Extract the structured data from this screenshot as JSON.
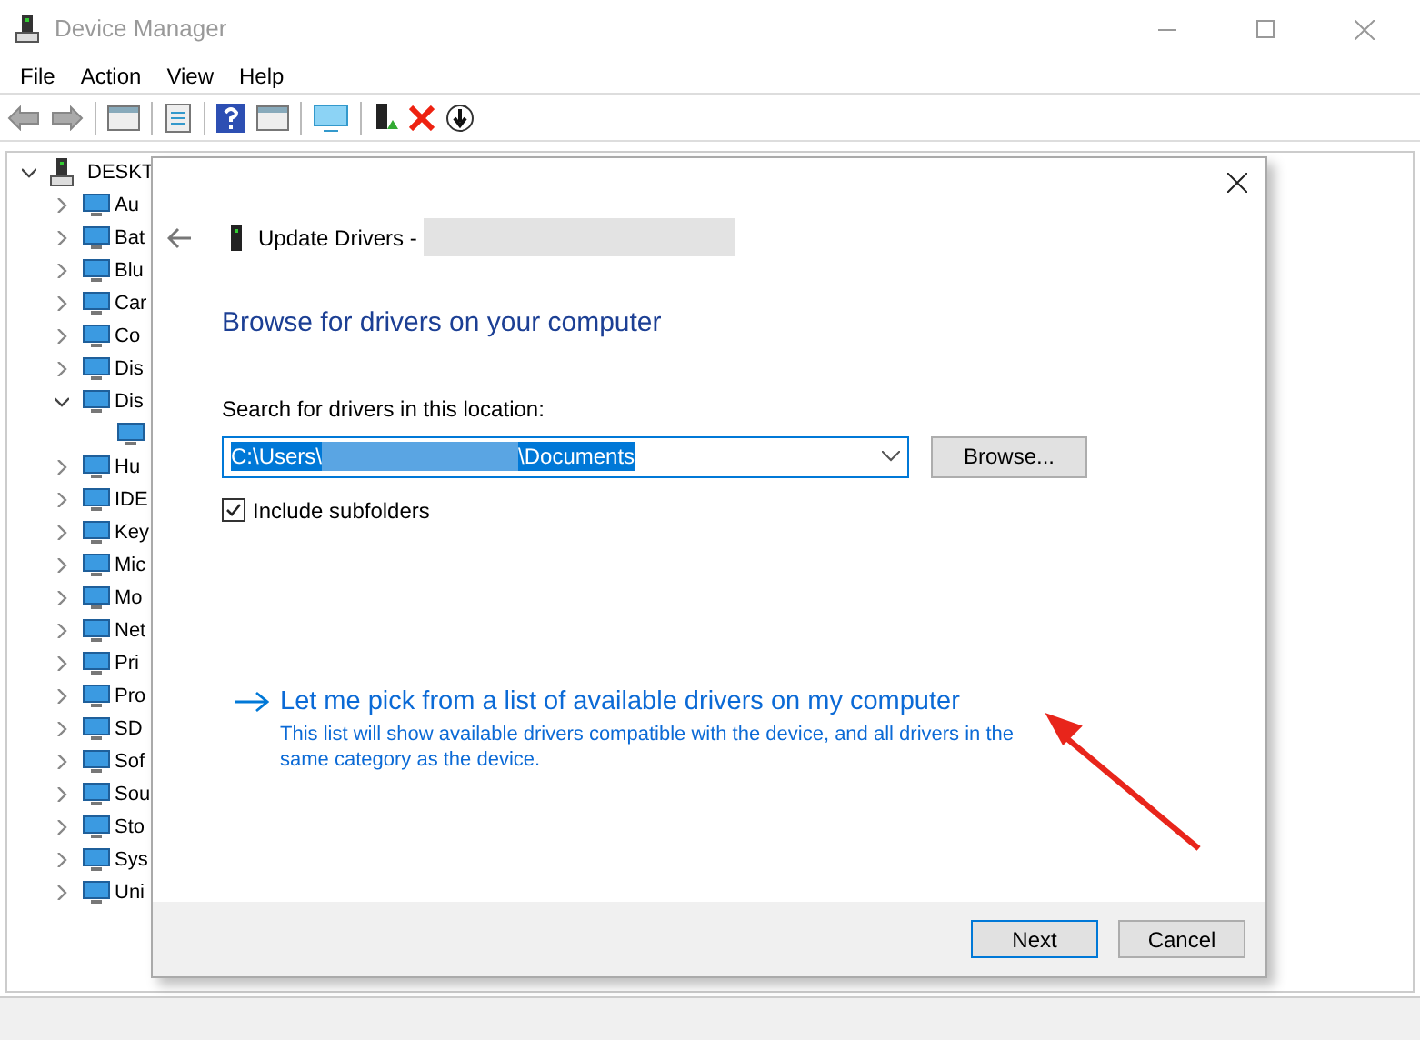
{
  "window": {
    "title": "Device Manager"
  },
  "menu": [
    "File",
    "Action",
    "View",
    "Help"
  ],
  "tree": {
    "root": {
      "label": "DESKT",
      "expanded": true
    },
    "items": [
      {
        "label": "Au",
        "expanded": false
      },
      {
        "label": "Bat",
        "expanded": false
      },
      {
        "label": "Blu",
        "expanded": false
      },
      {
        "label": "Car",
        "expanded": false
      },
      {
        "label": "Co",
        "expanded": false
      },
      {
        "label": "Dis",
        "expanded": false
      },
      {
        "label": "Dis",
        "expanded": true,
        "children": [
          {
            "kind": "device"
          }
        ]
      },
      {
        "label": "Hu",
        "expanded": false
      },
      {
        "label": "IDE",
        "expanded": false
      },
      {
        "label": "Key",
        "expanded": false
      },
      {
        "label": "Mic",
        "expanded": false
      },
      {
        "label": "Mo",
        "expanded": false
      },
      {
        "label": "Net",
        "expanded": false
      },
      {
        "label": "Pri",
        "expanded": false
      },
      {
        "label": "Pro",
        "expanded": false
      },
      {
        "label": "SD",
        "expanded": false
      },
      {
        "label": "Sof",
        "expanded": false
      },
      {
        "label": "Sou",
        "expanded": false
      },
      {
        "label": "Sto",
        "expanded": false
      },
      {
        "label": "Sys",
        "expanded": false
      },
      {
        "label": "Uni",
        "expanded": false
      }
    ]
  },
  "dialog": {
    "title": "Update Drivers -",
    "heading": "Browse for drivers on your computer",
    "search_label": "Search for drivers in this location:",
    "path_start": "C:\\Users\\",
    "path_end": "\\Documents",
    "browse_button": "Browse...",
    "include_subfolders": {
      "label": "Include subfolders",
      "checked": true
    },
    "link": {
      "title": "Let me pick from a list of available drivers on my computer",
      "description": "This list will show available drivers compatible with the device, and all drivers in the same category as the device."
    },
    "buttons": [
      {
        "label": "Next",
        "default": true
      },
      {
        "label": "Cancel",
        "default": false
      }
    ]
  }
}
